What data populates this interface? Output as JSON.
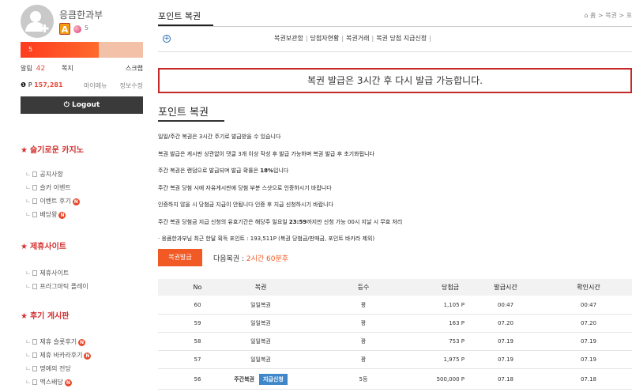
{
  "profile": {
    "username": "응큼한과부",
    "level_badge": "A",
    "level_num": "5",
    "exp_text": "5",
    "exp_fraction": 0.64
  },
  "stats": {
    "alarm_label": "알림",
    "alarm_count": "42",
    "note_label": "쪽지",
    "scrap_label": "스크랩"
  },
  "points": {
    "prefix": "P",
    "value": "157,281",
    "my_info": "마이메뉴",
    "edit_info": "정보수정"
  },
  "logout_label": "Logout",
  "menus": [
    {
      "title": "슬기로운 카지노",
      "items": [
        {
          "label": "공지사항",
          "new": false
        },
        {
          "label": "슬카 이벤트",
          "new": false
        },
        {
          "label": "이벤트 후기",
          "new": true
        },
        {
          "label": "배당왕",
          "new": true
        }
      ]
    },
    {
      "title": "제휴사이트",
      "items": [
        {
          "label": "제휴사이트",
          "new": false
        },
        {
          "label": "프라그마틱 플레이",
          "new": false
        }
      ]
    },
    {
      "title": "후기 게시판",
      "items": [
        {
          "label": "제휴 슬롯후기",
          "new": true
        },
        {
          "label": "제휴 바카라후기",
          "new": true
        },
        {
          "label": "명예의 전당",
          "new": false
        },
        {
          "label": "맥스배당",
          "new": true
        }
      ]
    }
  ],
  "new_badge": "N",
  "page_title": "포인트 복권",
  "breadcrumb": "홈 > 복권 > 포",
  "subnav": {
    "links": [
      "복권보관함",
      "당첨자현황",
      "복권거래",
      "복권 당첨 지급신청"
    ]
  },
  "alert_text": "복권 발급은 3시간 후 다시 발급 가능합니다.",
  "section_title": "포인트 복권",
  "notices": [
    {
      "text": "일일/주간 복권은 3시간 주기로 발급받을 수 있습니다",
      "bold": ""
    },
    {
      "text": "복권 발급은 게시판 상관없이 댓글 3개 이상 작성 후 발급 가능하며 복권 발급 후 초기화됩니다",
      "bold": ""
    },
    {
      "text": "주간 복권은 랜덤으로 발급되며 발급 확률은 ",
      "bold": "18%",
      "after": "입니다"
    },
    {
      "text": "주간 복권 당첨 시에 자유게시판에 당첨 부분 스샷으로 인증하시기 바랍니다",
      "bold": ""
    },
    {
      "text": "인증하지 않을 시 당첨금 지급이 안됩니다 인증 후 지급 신청하시기 바랍니다",
      "bold": ""
    },
    {
      "text": "주간 복권 당첨금 지급 신청의 유효기간은 해당주 일요일 ",
      "bold": "23:59",
      "after": "까지만 신청 가능 00시 지날 시 무효 처리"
    },
    {
      "text": "· 응큼한과부님 최근 한달 획득 포인트 : 193,511P (복권 당첨금/판매금, 포인트 바카라 제외)",
      "bold": ""
    }
  ],
  "issue_button": "복권발급",
  "next_ticket_label": "다음복권 :",
  "next_ticket_value": "2시간 60분후",
  "table": {
    "headers": [
      "No",
      "복권",
      "등수",
      "당첨금",
      "발급시간",
      "확인시간"
    ],
    "rows": [
      {
        "no": "60",
        "name": "일일복권",
        "rank": "꽝",
        "prize": "1,105 P",
        "issued": "00:47",
        "confirmed": "00:47",
        "claim": ""
      },
      {
        "no": "59",
        "name": "일일복권",
        "rank": "꽝",
        "prize": "163 P",
        "issued": "07.20",
        "confirmed": "07.20",
        "claim": ""
      },
      {
        "no": "58",
        "name": "일일복권",
        "rank": "꽝",
        "prize": "753 P",
        "issued": "07.19",
        "confirmed": "07.19",
        "claim": ""
      },
      {
        "no": "57",
        "name": "일일복권",
        "rank": "꽝",
        "prize": "1,975 P",
        "issued": "07.19",
        "confirmed": "07.19",
        "claim": ""
      },
      {
        "no": "56",
        "name": "주간복권",
        "rank": "5등",
        "prize": "500,000 P",
        "issued": "07.18",
        "confirmed": "07.18",
        "claim": "지급신청"
      }
    ]
  },
  "colors": {
    "accent": "#f15a24",
    "menu_title": "#d32f2f",
    "alert_border": "#c62828",
    "claim_button": "#3f87c9"
  },
  "icons": [
    "user-add-icon",
    "power-icon",
    "star-icon",
    "plus-circle-icon",
    "home-icon",
    "document-icon"
  ]
}
